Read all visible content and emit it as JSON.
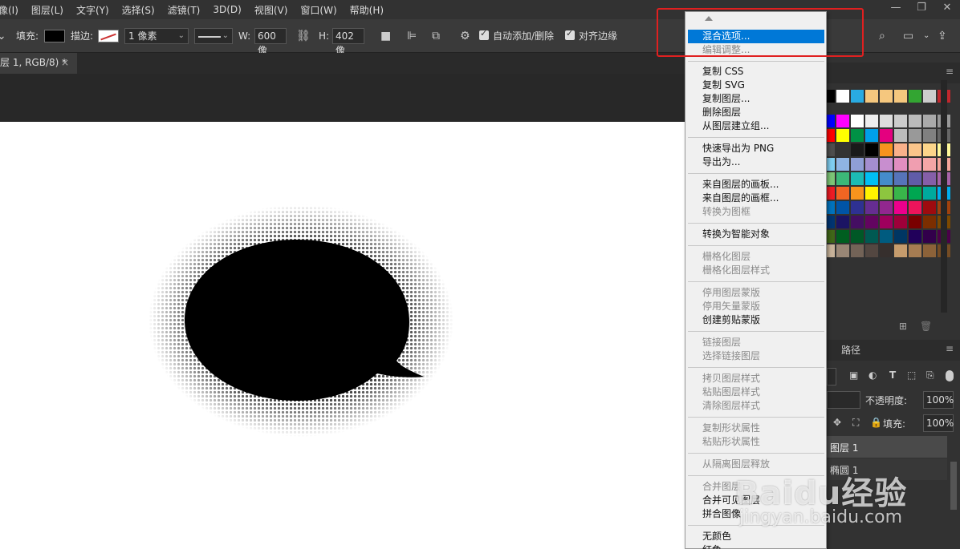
{
  "menubar": {
    "items": [
      "像(I)",
      "图层(L)",
      "文字(Y)",
      "选择(S)",
      "滤镜(T)",
      "3D(D)",
      "视图(V)",
      "窗口(W)",
      "帮助(H)"
    ]
  },
  "optbar": {
    "fill_label": "填充:",
    "stroke_label": "描边:",
    "stroke_width": "1 像素",
    "w_label": "W:",
    "w_value": "600 像",
    "h_label": "H:",
    "h_value": "402 像",
    "auto_add_label": "自动添加/删除",
    "align_edges_label": "对齐边缘"
  },
  "doc_tab": {
    "title": "层 1, RGB/8) *",
    "close": "×"
  },
  "context_menu": {
    "blend_options": "混合选项...",
    "edit_adjust": "编辑调整...",
    "copy_css": "复制 CSS",
    "copy_svg": "复制 SVG",
    "duplicate_layer": "复制图层...",
    "delete_layer": "删除图层",
    "group_from_layers": "从图层建立组...",
    "quick_export_png": "快速导出为 PNG",
    "export_as": "导出为...",
    "artboard_from_layers": "来自图层的画板...",
    "frame_from_layers": "来自图层的画框...",
    "convert_to_frame": "转换为图框",
    "convert_to_smart": "转换为智能对象",
    "rasterize_layer": "栅格化图层",
    "rasterize_layer_style": "栅格化图层样式",
    "disable_layer_mask": "停用图层蒙版",
    "disable_vector_mask": "停用矢量蒙版",
    "create_clipping_mask": "创建剪贴蒙版",
    "link_layers": "链接图层",
    "select_linked_layers": "选择链接图层",
    "copy_layer_style": "拷贝图层样式",
    "paste_layer_style": "粘贴图层样式",
    "clear_layer_style": "清除图层样式",
    "copy_shape_attrs": "复制形状属性",
    "paste_shape_attrs": "粘贴形状属性",
    "release_from_isolation": "从隔离图层释放",
    "merge_layers": "合并图层",
    "merge_visible": "合并可见图层",
    "flatten_image": "拼合图像",
    "no_color": "无颜色",
    "red": "红色"
  },
  "layers_panel": {
    "paths_tab": "路径",
    "opacity_label": "不透明度:",
    "opacity_value": "100%",
    "fill_label": "填充:",
    "fill_value": "100%",
    "layer1_name": "图层 1",
    "layer2_name": "椭圆 1"
  },
  "watermark": {
    "brand": "Baidu经验",
    "url": "jingyan.baidu.com"
  },
  "colors": {
    "accent": "#0078d7",
    "highlight_box": "#e02020",
    "swatches": [
      [
        "#000000",
        "#ffffff",
        "#29abe2",
        "#f5c77e",
        "#f5c77e",
        "#f5c77e",
        "#33a532",
        "#cccccc",
        "#c1272d"
      ],
      [
        "#0000ff",
        "#ff00ff",
        "#ffffff",
        "#eeeeee",
        "#dddddd",
        "#cccccc",
        "#bbbbbb",
        "#aaaaaa",
        "#999999"
      ],
      [
        "#ff0000",
        "#ffff00",
        "#009245",
        "#00a0e9",
        "#e4007f",
        "#bbbbbb",
        "#999999",
        "#808080",
        "#666666"
      ],
      [
        "#4d4d4d",
        "#333333",
        "#1a1a1a",
        "#000000",
        "#f7931e",
        "#f9b08a",
        "#fbc58a",
        "#fcd58a",
        "#fff799"
      ],
      [
        "#7fcdf0",
        "#8fb4e3",
        "#8f9fd6",
        "#a48ecf",
        "#c88ecf",
        "#e28ec0",
        "#f09eb0",
        "#f4a6a6",
        "#f6a59a"
      ],
      [
        "#7cc576",
        "#3cb878",
        "#1cbbb4",
        "#00bff3",
        "#448ccb",
        "#5674b9",
        "#605ca8",
        "#855fa8",
        "#a763a8"
      ],
      [
        "#ed1c24",
        "#f26522",
        "#f7941d",
        "#fff200",
        "#8dc63f",
        "#39b54a",
        "#00a651",
        "#00a99d",
        "#00aeef"
      ],
      [
        "#0072bc",
        "#0054a6",
        "#2e3192",
        "#662d91",
        "#92278f",
        "#ec008c",
        "#ed145b",
        "#9e0b0f",
        "#a0410d"
      ],
      [
        "#003471",
        "#1b1464",
        "#440e62",
        "#630460",
        "#9e005d",
        "#9e0039",
        "#790000",
        "#7b2e00",
        "#7d4900"
      ],
      [
        "#406618",
        "#005e20",
        "#005826",
        "#005952",
        "#005b7f",
        "#003663",
        "#21005a",
        "#32004b",
        "#4b0049"
      ],
      [
        "#c7b299",
        "#998675",
        "#736357",
        "#534741",
        "#362f2d",
        "#c69c6d",
        "#a67c52",
        "#8c6239",
        "#754c24"
      ]
    ]
  }
}
